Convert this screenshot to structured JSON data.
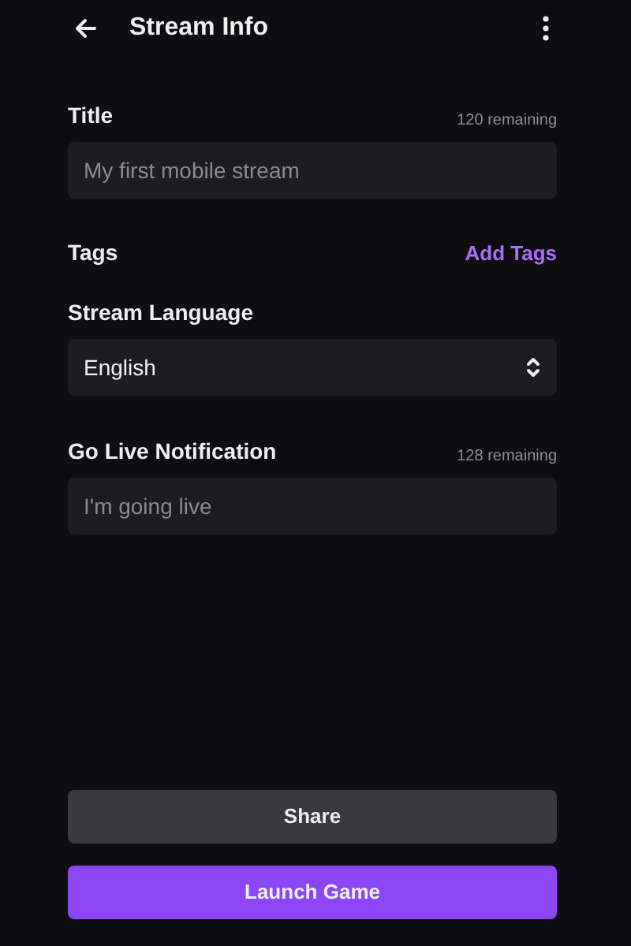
{
  "header": {
    "title": "Stream Info"
  },
  "title_field": {
    "label": "Title",
    "counter": "120 remaining",
    "placeholder": "My first mobile stream"
  },
  "tags": {
    "label": "Tags",
    "action": "Add Tags"
  },
  "language": {
    "label": "Stream Language",
    "value": "English"
  },
  "notification_field": {
    "label": "Go Live Notification",
    "counter": "128 remaining",
    "placeholder": "I'm going live"
  },
  "buttons": [
    {
      "label": "Share",
      "kind": "secondary"
    },
    {
      "label": "Launch Game",
      "kind": "primary"
    }
  ]
}
